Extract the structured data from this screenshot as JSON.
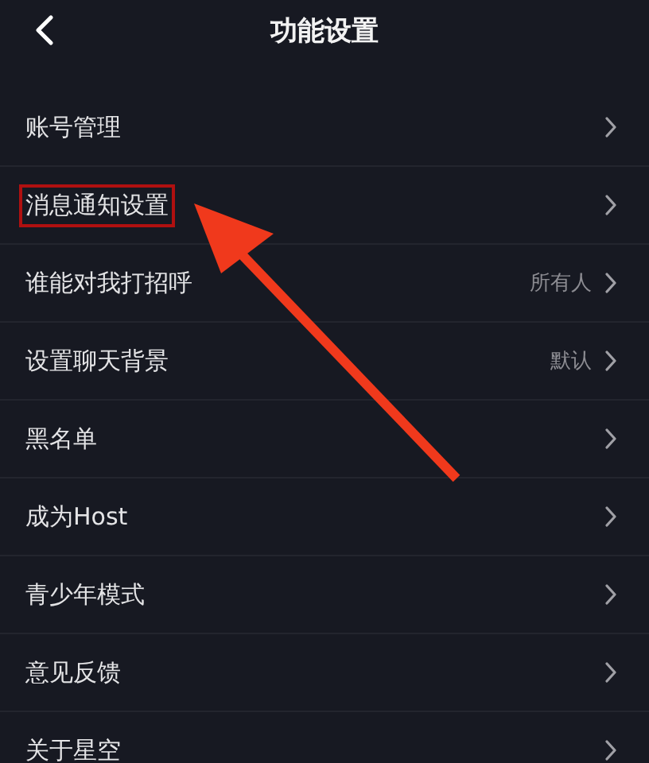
{
  "header": {
    "title": "功能设置"
  },
  "items": [
    {
      "label": "账号管理",
      "highlighted": false
    },
    {
      "label": "消息通知设置",
      "highlighted": true
    },
    {
      "label": "谁能对我打招呼",
      "value": "所有人",
      "highlighted": false
    },
    {
      "label": "设置聊天背景",
      "value": "默认",
      "highlighted": false
    },
    {
      "label": "黑名单",
      "highlighted": false
    },
    {
      "label": "成为Host",
      "highlighted": false
    },
    {
      "label": "青少年模式",
      "highlighted": false
    },
    {
      "label": "意见反馈",
      "highlighted": false
    },
    {
      "label": "关于星空",
      "highlighted": false
    }
  ],
  "annotation": {
    "kind": "arrow"
  }
}
